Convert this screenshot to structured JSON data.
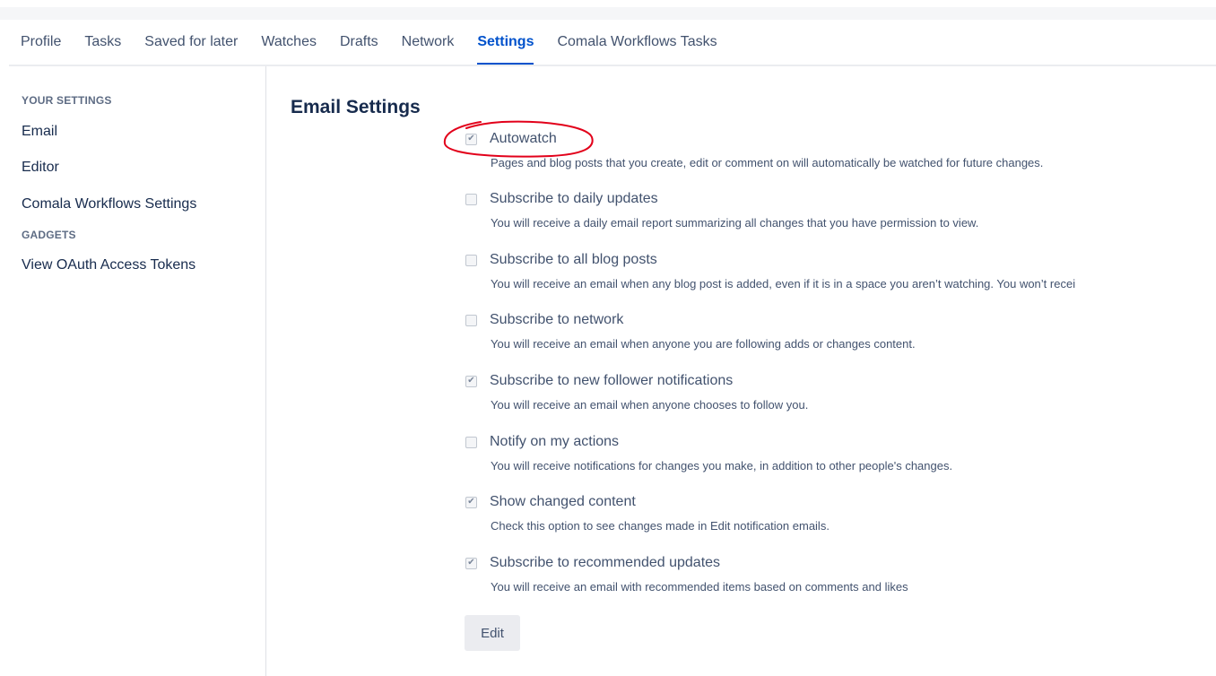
{
  "tabs": [
    {
      "label": "Profile",
      "active": false
    },
    {
      "label": "Tasks",
      "active": false
    },
    {
      "label": "Saved for later",
      "active": false
    },
    {
      "label": "Watches",
      "active": false
    },
    {
      "label": "Drafts",
      "active": false
    },
    {
      "label": "Network",
      "active": false
    },
    {
      "label": "Settings",
      "active": true
    },
    {
      "label": "Comala Workflows Tasks",
      "active": false
    }
  ],
  "sidebar": {
    "your_settings_heading": "YOUR SETTINGS",
    "items": [
      "Email",
      "Editor",
      "Comala Workflows Settings"
    ],
    "gadgets_heading": "GADGETS",
    "gadget_items": [
      "View OAuth Access Tokens"
    ]
  },
  "main": {
    "title": "Email Settings",
    "options": [
      {
        "label": "Autowatch",
        "checked": true,
        "description": "Pages and blog posts that you create, edit or comment on will automatically be watched for future changes."
      },
      {
        "label": "Subscribe to daily updates",
        "checked": false,
        "description": "You will receive a daily email report summarizing all changes that you have permission to view."
      },
      {
        "label": "Subscribe to all blog posts",
        "checked": false,
        "description": "You will receive an email when any blog post is added, even if it is in a space you aren’t watching. You won’t recei"
      },
      {
        "label": "Subscribe to network",
        "checked": false,
        "description": "You will receive an email when anyone you are following adds or changes content."
      },
      {
        "label": "Subscribe to new follower notifications",
        "checked": true,
        "description": "You will receive an email when anyone chooses to follow you."
      },
      {
        "label": "Notify on my actions",
        "checked": false,
        "description": "You will receive notifications for changes you make, in addition to other people's changes."
      },
      {
        "label": "Show changed content",
        "checked": true,
        "description": "Check this option to see changes made in Edit notification emails."
      },
      {
        "label": "Subscribe to recommended updates",
        "checked": true,
        "description": "You will receive an email with recommended items based on comments and likes"
      }
    ],
    "edit_label": "Edit"
  },
  "colors": {
    "accent": "#0052cc",
    "annotation": "#e2001a"
  }
}
